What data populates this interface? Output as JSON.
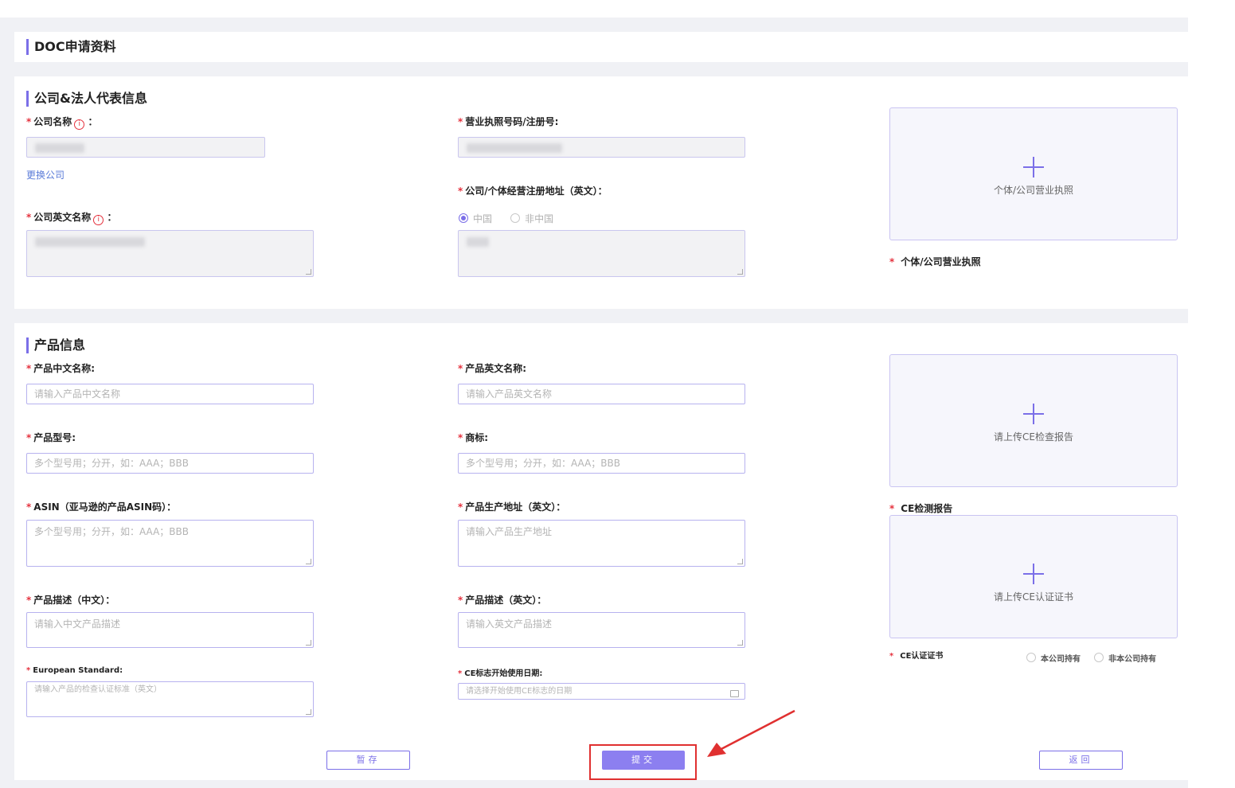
{
  "header": {
    "title": "DOC申请资料"
  },
  "company": {
    "title": "公司&法人代表信息",
    "name_label": "公司名称",
    "name_colon": "：",
    "change_link": "更换公司",
    "en_name_label": "公司英文名称",
    "en_name_colon": "：",
    "license_no_label": "营业执照号码/注册号:",
    "address_label": "公司/个体经营注册地址（英文）：",
    "radio_china": "中国",
    "radio_non_china": "非中国",
    "upload_text": "个体/公司营业执照",
    "upload_label": "个体/公司营业执照"
  },
  "product": {
    "title": "产品信息",
    "cn_name_label": "产品中文名称:",
    "cn_name_placeholder": "请输入产品中文名称",
    "en_name_label": "产品英文名称:",
    "en_name_placeholder": "请输入产品英文名称",
    "model_label": "产品型号:",
    "model_placeholder": "多个型号用；分开，如：AAA；BBB",
    "brand_label": "商标:",
    "brand_placeholder": "多个型号用；分开，如：AAA；BBB",
    "asin_label": "ASIN（亚马逊的产品ASIN码）：",
    "asin_placeholder": "多个型号用；分开，如：AAA；BBB",
    "address_label": "产品生产地址（英文）：",
    "address_placeholder": "请输入产品生产地址",
    "desc_cn_label": "产品描述（中文）：",
    "desc_cn_placeholder": "请输入中文产品描述",
    "desc_en_label": "产品描述（英文）：",
    "desc_en_placeholder": "请输入英文产品描述",
    "standard_label": "European Standard:",
    "standard_placeholder": "请输入产品的检查认证标准（英文）",
    "ce_date_label": "CE标志开始使用日期:",
    "ce_date_placeholder": "请选择开始使用CE标志的日期",
    "ce_report_upload_text": "请上传CE检查报告",
    "ce_report_label": "CE检测报告",
    "ce_cert_upload_text": "请上传CE认证证书",
    "ce_cert_label": "CE认证证书",
    "radio_own": "本公司持有",
    "radio_not_own": "非本公司持有"
  },
  "actions": {
    "save": "暂存",
    "submit": "提交",
    "back": "返回"
  },
  "required_mark": "*",
  "info_glyph": "i",
  "colors": {
    "accent": "#7b6fe8",
    "required": "#e5323e",
    "highlight": "#e03030"
  }
}
